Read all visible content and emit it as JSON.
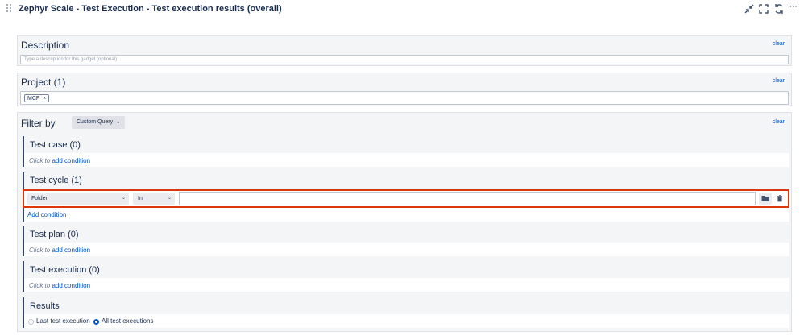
{
  "header": {
    "title": "Zephyr Scale - Test Execution - Test execution results (overall)",
    "icons": [
      "minimize-icon",
      "fullscreen-icon",
      "refresh-icon",
      "more-icon"
    ],
    "more_label": "···"
  },
  "description": {
    "title": "Description",
    "clear": "clear",
    "placeholder": "Type a description for this gadget (optional)"
  },
  "project": {
    "title": "Project (1)",
    "clear": "clear",
    "tag": "MCF",
    "tag_remove": "×"
  },
  "filter": {
    "title": "Filter by",
    "query_type": "Custom Query",
    "clear": "clear",
    "test_case": {
      "title": "Test case (0)",
      "click_to": "Click to",
      "add_condition": "add condition"
    },
    "test_cycle": {
      "title": "Test cycle (1)",
      "field": "Folder",
      "operator": "In",
      "value": "",
      "add_condition": "Add condition"
    },
    "test_plan": {
      "title": "Test plan (0)",
      "click_to": "Click to",
      "add_condition": "add condition"
    },
    "test_execution": {
      "title": "Test execution (0)",
      "click_to": "Click to",
      "add_condition": "add condition"
    },
    "results": {
      "title": "Results",
      "options": [
        {
          "label": "Last test execution",
          "checked": false
        },
        {
          "label": "All test executions",
          "checked": true
        }
      ]
    }
  },
  "colors": {
    "link": "#0052cc",
    "highlight_border": "#de350b",
    "accent_bar": "#344563"
  }
}
